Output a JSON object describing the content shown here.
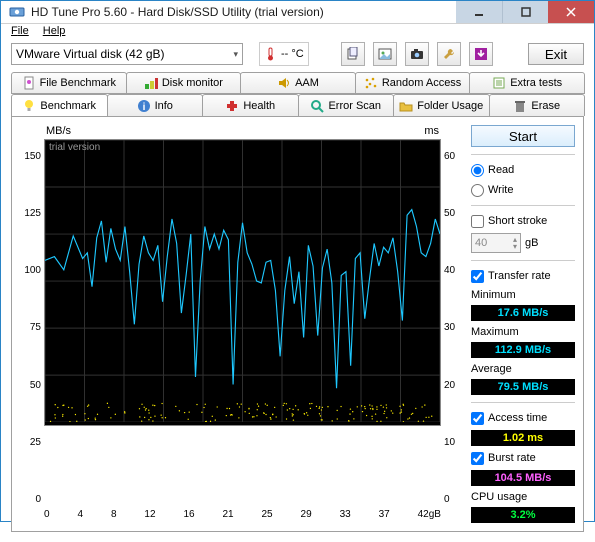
{
  "window": {
    "title": "HD Tune Pro 5.60 - Hard Disk/SSD Utility (trial version)"
  },
  "menu": {
    "file": "File",
    "help": "Help"
  },
  "toolbar": {
    "drive": "VMware  Virtual disk (42 gB)",
    "temp": "-- °C",
    "exit": "Exit"
  },
  "tabs_row1": {
    "file_bm": "File Benchmark",
    "disk_mon": "Disk monitor",
    "aam": "AAM",
    "rand": "Random Access",
    "extra": "Extra tests"
  },
  "tabs_row2": {
    "bench": "Benchmark",
    "info": "Info",
    "health": "Health",
    "error": "Error Scan",
    "folder": "Folder Usage",
    "erase": "Erase"
  },
  "chart": {
    "ylabel_l": "MB/s",
    "ylabel_r": "ms",
    "watermark": "trial version",
    "y_left": [
      "150",
      "125",
      "100",
      "75",
      "50",
      "25",
      "0"
    ],
    "y_right": [
      "60",
      "50",
      "40",
      "30",
      "20",
      "10",
      "0"
    ],
    "x_ticks": [
      "0",
      "4",
      "8",
      "12",
      "16",
      "21",
      "25",
      "29",
      "33",
      "37",
      "42gB"
    ]
  },
  "panel": {
    "start": "Start",
    "read": "Read",
    "write": "Write",
    "short_stroke": "Short stroke",
    "stroke_val": "40",
    "stroke_unit": "gB",
    "transfer_rate": "Transfer rate",
    "minimum": "Minimum",
    "minimum_v": "17.6 MB/s",
    "maximum": "Maximum",
    "maximum_v": "112.9 MB/s",
    "average": "Average",
    "average_v": "79.5 MB/s",
    "access_time": "Access time",
    "access_time_v": "1.02 ms",
    "burst_rate": "Burst rate",
    "burst_rate_v": "104.5 MB/s",
    "cpu_usage": "CPU usage",
    "cpu_usage_v": "3.2%"
  },
  "chart_data": {
    "type": "line",
    "title": "",
    "xlabel": "gB",
    "ylabel": "MB/s",
    "xlim": [
      0,
      42
    ],
    "ylim": [
      0,
      150
    ],
    "ylim_right_ms": [
      0,
      60
    ],
    "x": [
      0,
      1,
      2,
      3,
      4,
      4.5,
      5,
      5.5,
      6,
      6.5,
      7,
      7.5,
      8,
      8.5,
      9,
      9.5,
      10,
      10.5,
      11,
      11.5,
      12,
      12.5,
      13,
      13.5,
      14,
      14.5,
      15,
      15.5,
      16,
      16.5,
      17,
      17.5,
      18,
      18.5,
      19,
      19.5,
      20,
      20.5,
      21,
      21.5,
      22,
      22.5,
      23,
      23.5,
      24,
      24.5,
      25,
      25.5,
      26,
      26.5,
      27,
      27.5,
      28,
      28.5,
      29,
      29.5,
      30,
      30.5,
      31,
      31.5,
      32,
      32.5,
      33,
      33.5,
      34,
      34.5,
      35,
      35.5,
      36,
      36.5,
      37,
      37.5,
      38,
      38.5,
      39,
      39.5,
      40,
      40.5,
      41,
      41.5,
      42
    ],
    "series": [
      {
        "name": "Transfer rate (MB/s)",
        "axis": "left",
        "values": [
          86,
          88,
          81,
          99,
          87,
          90,
          72,
          98,
          107,
          85,
          103,
          92,
          86,
          104,
          80,
          52,
          84,
          99,
          90,
          86,
          94,
          64,
          88,
          108,
          95,
          58,
          78,
          100,
          24,
          75,
          104,
          92,
          100,
          92,
          102,
          97,
          20,
          85,
          106,
          90,
          84,
          75,
          74,
          85,
          86,
          70,
          35,
          70,
          88,
          63,
          80,
          45,
          94,
          83,
          46,
          82,
          92,
          74,
          18,
          78,
          80,
          30,
          87,
          90,
          55,
          76,
          95,
          83,
          93,
          90,
          98,
          80,
          54,
          110,
          113,
          104,
          90,
          88,
          95,
          108,
          100
        ]
      }
    ],
    "access_time_scatter": {
      "axis": "right",
      "note": "dots near bottom of chart, approx 0–4 ms, scattered across full x range",
      "approx_y_range_ms": [
        0,
        4
      ],
      "count_approx": 180
    }
  }
}
